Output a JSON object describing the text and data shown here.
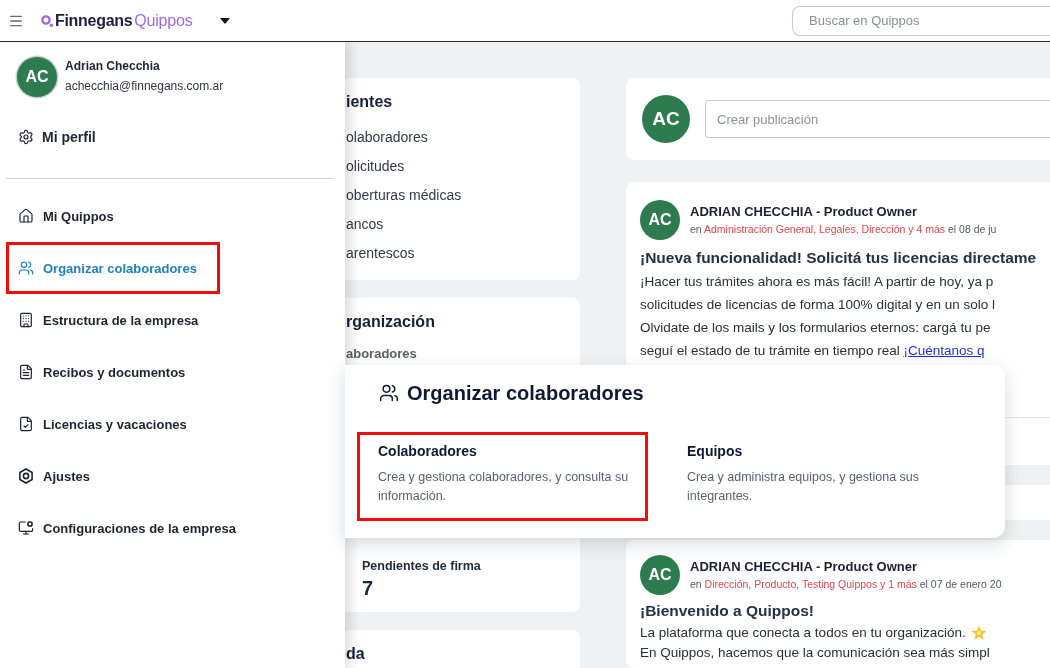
{
  "top_bar": {
    "brand": {
      "name": "Finnegans",
      "product": "Quippos"
    },
    "search": {
      "placeholder": "Buscar en Quippos"
    }
  },
  "drawer": {
    "user": {
      "initials": "AC",
      "name": "Adrian Checchia",
      "email": "achecchia@finnegans.com.ar"
    },
    "profile_link": {
      "label": "Mi perfil"
    },
    "items": [
      {
        "kind": "home",
        "label": "Mi Quippos",
        "selected": false,
        "highlighted": false
      },
      {
        "kind": "users",
        "label": "Organizar colaboradores",
        "selected": true,
        "highlighted": true
      },
      {
        "kind": "building",
        "label": "Estructura de la empresa",
        "selected": false,
        "highlighted": false
      },
      {
        "kind": "document",
        "label": "Recibos y documentos",
        "selected": false,
        "highlighted": false
      },
      {
        "kind": "document-check",
        "label": "Licencias y vacaciones",
        "selected": false,
        "highlighted": false
      },
      {
        "kind": "hexagon",
        "label": "Ajustes",
        "selected": false,
        "highlighted": false
      },
      {
        "kind": "monitor-settings",
        "label": "Configuraciones de la empresa",
        "selected": false,
        "highlighted": false
      }
    ]
  },
  "middle_column": {
    "cards": [
      {
        "heading": "ientes",
        "links": [
          "olaboradores",
          "olicitudes",
          "oberturas médicas",
          "ancos",
          "arentescos"
        ]
      },
      {
        "heading": "rganización",
        "rows": [
          "aboradores"
        ],
        "stat": {
          "label": "Pendientes de firma",
          "value": "7"
        }
      },
      {
        "heading": "da"
      }
    ]
  },
  "feed": {
    "composer": {
      "initials": "AC",
      "placeholder": "Crear publicación"
    },
    "posts": [
      {
        "initials": "AC",
        "author": "ADRIAN CHECCHIA - Product Owner",
        "prefix": "en",
        "audience": "Administración General, Legales, Dirección y 4 más",
        "date": "el 08 de ju",
        "title": "¡Nueva funcionalidad! Solicitá tus licencias directame",
        "lines": [
          {
            "text": "¡Hacer tus trámites ahora es más fácil! A partir de hoy, ya p"
          },
          {
            "text": "solicitudes de licencias de forma 100% digital y en un solo l"
          },
          {
            "text": "Olvidate de los mails y los formularios eternos: cargá tu pe"
          },
          {
            "text": "seguí el estado de tu trámite en tiempo real",
            "link": "¡Cuéntanos q"
          }
        ]
      },
      {
        "initials": "AC",
        "author": "ADRIAN CHECCHIA - Product Owner",
        "prefix": "en",
        "audience": "Dirección, Producto, Testing Quippos y 1 más",
        "date": "el 07 de enero 20",
        "title": "¡Bienvenido a Quippos!",
        "lines": [
          {
            "text": "La plataforma que conecta a todos en tu organización.",
            "emoji": true
          },
          {
            "text": "En Quippos, hacemos que la comunicación sea más simpl"
          }
        ]
      }
    ]
  },
  "popover": {
    "title": "Organizar colaboradores",
    "options": [
      {
        "title": "Colaboradores",
        "description": "Crea y gestiona colaboradores, y consulta su información.",
        "highlighted": true
      },
      {
        "title": "Equipos",
        "description": "Crea y administra equipos, y gestiona sus integrantes.",
        "highlighted": false
      }
    ]
  }
}
